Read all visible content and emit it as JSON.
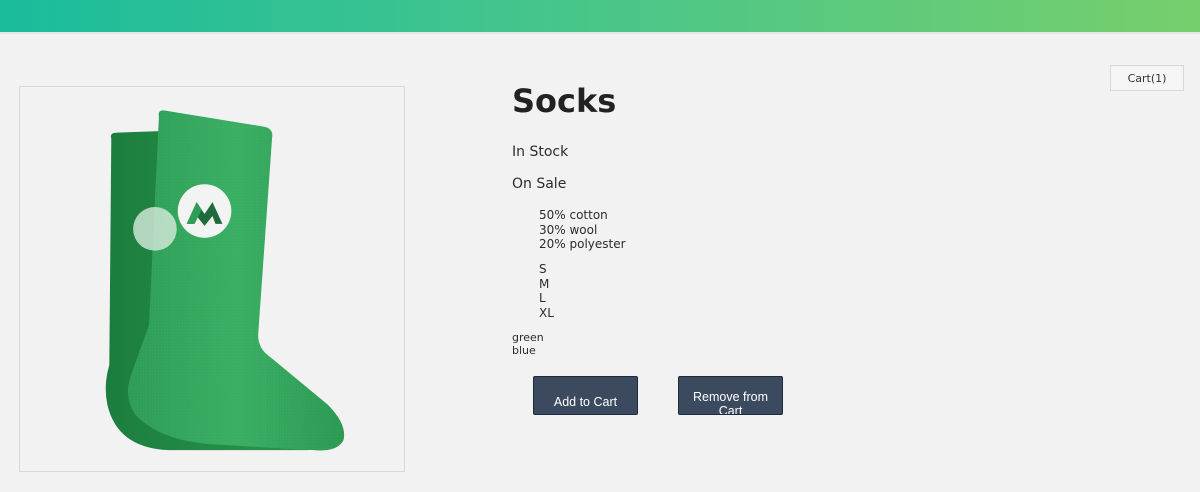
{
  "nav": {
    "bar_color_start": "#1abc9c",
    "bar_color_end": "#77cf6c"
  },
  "cart": {
    "label": "Cart(1)"
  },
  "product": {
    "image_icon": "green-socks-image",
    "title": "Socks",
    "stock": "In Stock",
    "sale": "On Sale",
    "details": [
      "50% cotton",
      "30% wool",
      "20% polyester"
    ],
    "sizes": [
      "S",
      "M",
      "L",
      "XL"
    ],
    "colors": [
      "green",
      "blue"
    ]
  },
  "actions": {
    "add_label": "Add to Cart",
    "remove_label": "Remove from Cart",
    "button_color": "#3c4a60"
  }
}
